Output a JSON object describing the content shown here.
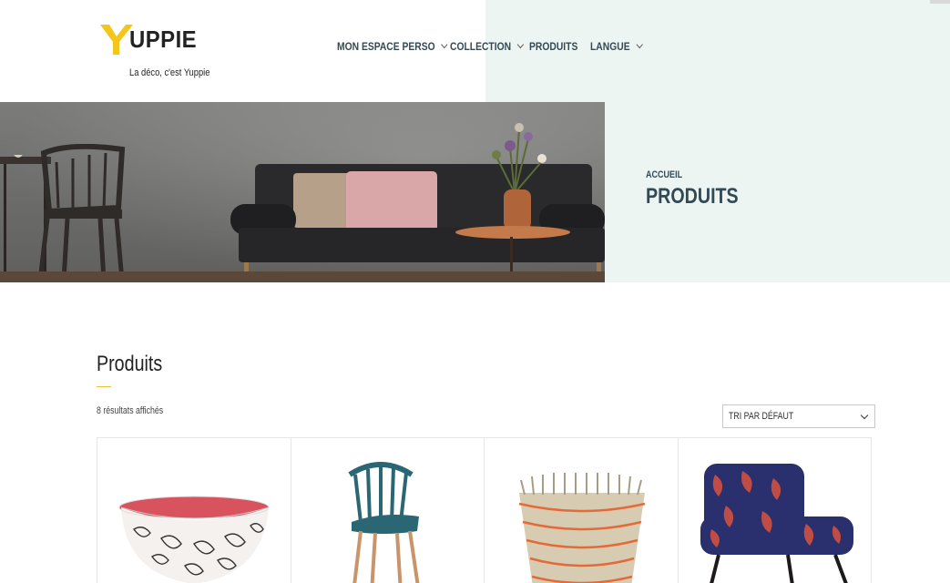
{
  "brand": {
    "logo_word": "UPPIE",
    "logo_letter": "Y",
    "tagline": "La déco, c'est Yuppie",
    "accent_color": "#f3c619"
  },
  "nav": {
    "items": [
      {
        "label": "MON ESPACE PERSO",
        "has_dropdown": true
      },
      {
        "label": "COLLECTION",
        "has_dropdown": true
      },
      {
        "label": "PRODUITS",
        "has_dropdown": false
      },
      {
        "label": "LANGUE",
        "has_dropdown": true
      }
    ]
  },
  "page_header": {
    "breadcrumb": "ACCUEIL",
    "title": "PRODUITS"
  },
  "catalog": {
    "section_title": "Produits",
    "result_count": "8 résultats affichés",
    "sort_selected": "TRI PAR DÉFAUT"
  },
  "products": [
    {
      "icon": "bowl-product-image"
    },
    {
      "icon": "chair-product-image"
    },
    {
      "icon": "basket-product-image"
    },
    {
      "icon": "armchair-product-image"
    }
  ],
  "colors": {
    "nav_text": "#334a55",
    "header_panel_bg": "#edf5f3",
    "underline_accent": "#e8c23a"
  }
}
